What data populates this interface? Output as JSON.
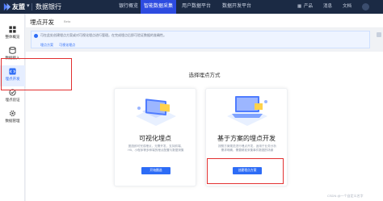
{
  "topbar": {
    "brand": "友盟",
    "product": "数据银行",
    "nav": [
      "银行概览",
      "智能数据采集",
      "用户数据平台",
      "数据开发平台"
    ],
    "right": [
      "产品",
      "消息",
      "文档"
    ]
  },
  "sidebar": {
    "items": [
      {
        "label": "整体概览",
        "icon": "grid-icon"
      },
      {
        "label": "数据接入",
        "icon": "database-icon"
      },
      {
        "label": "埋点开发",
        "icon": "code-icon",
        "active": true
      },
      {
        "label": "埋点验证",
        "icon": "check-icon"
      },
      {
        "label": "数据管理",
        "icon": "gear-icon"
      }
    ]
  },
  "page": {
    "title": "埋点开发",
    "tag": "Beta",
    "info_text": "可在此处创建埋点方案或对可视化埋点进行管理。在完成埋点后即可验证数据的准确性。",
    "info_links": [
      "埋点方案",
      "可视化埋点"
    ]
  },
  "main": {
    "title": "选择埋点方式",
    "cards": [
      {
        "title": "可视化埋点",
        "desc": "圈选即可完成埋点，无需开发，支持前端、H5、小程序等多种端的埋点配置与数据采集",
        "button": "开始圈选"
      },
      {
        "title": "基于方案的埋点开发",
        "desc": "按照方案规范进行埋点开发，适用于业务分析需求明确，需要精准采集事件数据的场景",
        "button": "创建埋点方案"
      }
    ]
  },
  "colors": {
    "topbar": "#1b2a44",
    "accent": "#2d6cf6",
    "highlight": "#e23030"
  },
  "watermark": "CSDN @一个自定义名字"
}
